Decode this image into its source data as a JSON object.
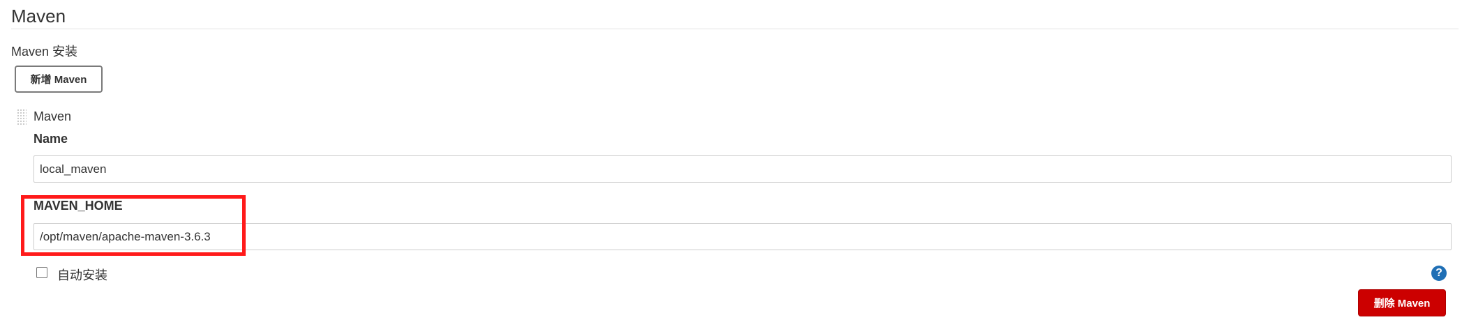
{
  "section": {
    "title": "Maven"
  },
  "installations": {
    "label": "Maven 安装",
    "add_button_label": "新增 Maven"
  },
  "item": {
    "title": "Maven",
    "name_label": "Name",
    "name_value": "local_maven",
    "home_label": "MAVEN_HOME",
    "home_value": "/opt/maven/apache-maven-3.6.3",
    "auto_install_label": "自动安装",
    "auto_install_checked": false,
    "help_icon_glyph": "?",
    "delete_button_label": "删除 Maven"
  },
  "colors": {
    "highlight": "#ff1a1a",
    "delete_button": "#cc0000",
    "help_icon": "#1f6fb5"
  },
  "icons": {
    "drag_handle": "drag-handle-icon",
    "help": "help-icon"
  }
}
